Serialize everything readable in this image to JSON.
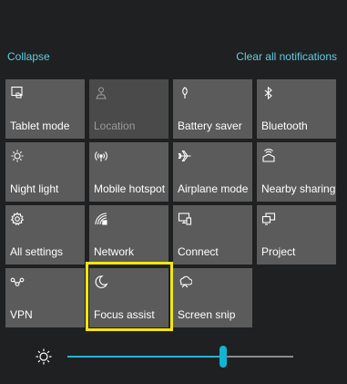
{
  "header": {
    "collapse_label": "Collapse",
    "clear_label": "Clear all notifications"
  },
  "tiles": [
    {
      "label": "Tablet mode",
      "icon": "tablet-mode-icon",
      "disabled": false
    },
    {
      "label": "Location",
      "icon": "location-icon",
      "disabled": true
    },
    {
      "label": "Battery saver",
      "icon": "battery-saver-icon",
      "disabled": false
    },
    {
      "label": "Bluetooth",
      "icon": "bluetooth-icon",
      "disabled": false
    },
    {
      "label": "Night light",
      "icon": "night-light-icon",
      "disabled": false
    },
    {
      "label": "Mobile hotspot",
      "icon": "mobile-hotspot-icon",
      "disabled": false
    },
    {
      "label": "Airplane mode",
      "icon": "airplane-icon",
      "disabled": false
    },
    {
      "label": "Nearby sharing",
      "icon": "nearby-sharing-icon",
      "disabled": false
    },
    {
      "label": "All settings",
      "icon": "gear-icon",
      "disabled": false
    },
    {
      "label": "Network",
      "icon": "network-icon",
      "disabled": false
    },
    {
      "label": "Connect",
      "icon": "connect-icon",
      "disabled": false
    },
    {
      "label": "Project",
      "icon": "project-icon",
      "disabled": false
    },
    {
      "label": "VPN",
      "icon": "vpn-icon",
      "disabled": false
    },
    {
      "label": "Focus assist",
      "icon": "moon-icon",
      "disabled": false
    },
    {
      "label": "Screen snip",
      "icon": "screen-snip-icon",
      "disabled": false
    }
  ],
  "brightness": {
    "icon": "brightness-icon",
    "level": 0.69
  },
  "colors": {
    "accent": "#1fb8d4",
    "link": "#5ccfe6",
    "tile": "#5b5b5b",
    "highlight": "#f5e60a",
    "background": "#1f2021"
  }
}
